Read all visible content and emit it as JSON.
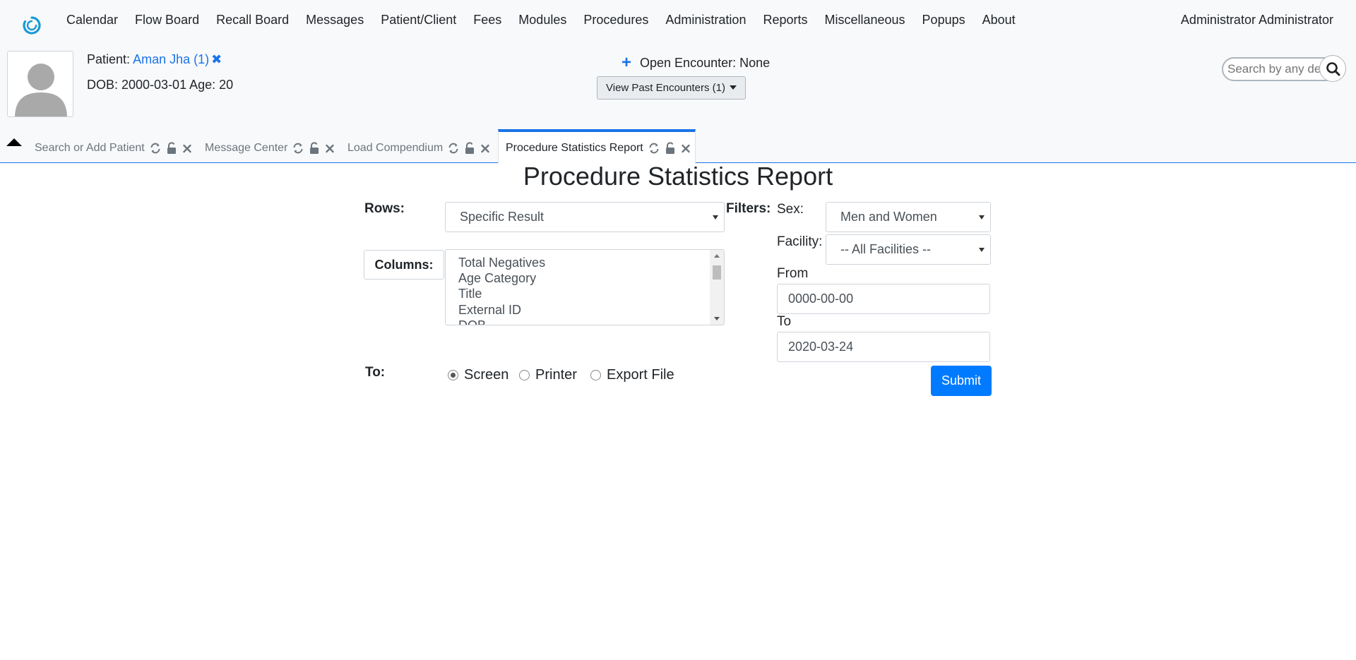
{
  "nav": {
    "items": [
      "Calendar",
      "Flow Board",
      "Recall Board",
      "Messages",
      "Patient/Client",
      "Fees",
      "Modules",
      "Procedures",
      "Administration",
      "Reports",
      "Miscellaneous",
      "Popups",
      "About"
    ],
    "user": "Administrator Administrator"
  },
  "patient": {
    "label": "Patient:",
    "name_link": "Aman Jha (1)",
    "close_glyph": "✖",
    "dob_age": "DOB: 2000-03-01 Age: 20"
  },
  "encounter": {
    "plus": "+",
    "open": "Open Encounter: None",
    "past": "View Past Encounters  (1)"
  },
  "search": {
    "placeholder": "Search by any demographics"
  },
  "tabs": [
    {
      "label": "Search or Add Patient"
    },
    {
      "label": "Message Center"
    },
    {
      "label": "Load Compendium"
    },
    {
      "label": "Procedure Statistics Report"
    }
  ],
  "report": {
    "title": "Procedure Statistics Report",
    "rows_label": "Rows:",
    "rows_value": "Specific Result",
    "columns_label": "Columns:",
    "columns_options": [
      "Total Negatives",
      "Age Category",
      "Title",
      "External ID",
      "DOB"
    ],
    "filters_label": "Filters:",
    "sex_label": "Sex:",
    "sex_value": "Men and Women",
    "facility_label": "Facility:",
    "facility_value": "-- All Facilities --",
    "from_label": "From",
    "from_value": "0000-00-00",
    "to_date_label": "To",
    "to_date_value": "2020-03-24",
    "to_label": "To:",
    "destinations": [
      {
        "label": "Screen",
        "checked": true
      },
      {
        "label": "Printer",
        "checked": false
      },
      {
        "label": "Export File",
        "checked": false
      }
    ],
    "submit": "Submit"
  },
  "colors": {
    "accent": "#1a73e8",
    "submit": "#007bff",
    "header_bg": "#f8f9fa"
  }
}
